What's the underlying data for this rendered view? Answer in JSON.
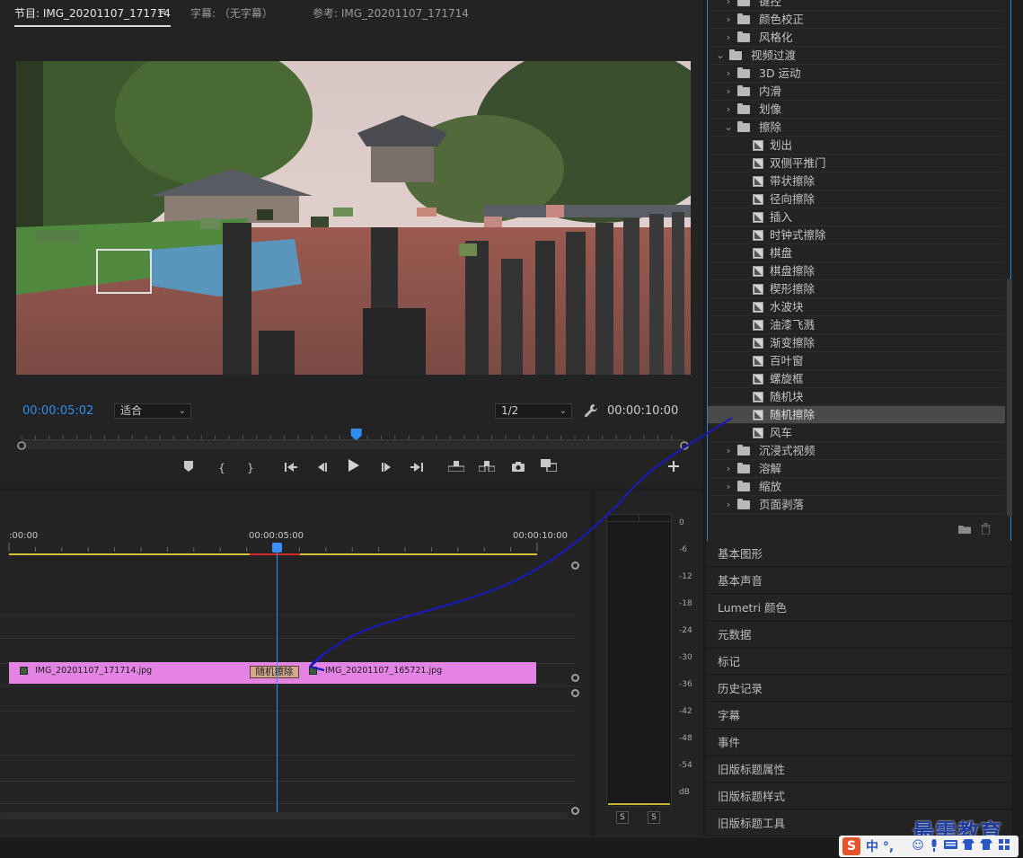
{
  "program_monitor": {
    "tab_active": "节目: IMG_20201107_171714",
    "tab_menu_icon": "hamburger-menu-icon",
    "tab_captions": "字幕: （无字幕）",
    "tab_reference": "参考: IMG_20201107_171714",
    "timecode_current": "00:00:05:02",
    "fit_option": "适合",
    "resolution_option": "1/2",
    "timecode_duration": "00:00:10:00",
    "playhead_progress": 0.505,
    "controls": [
      "marker-icon",
      "in-point-icon",
      "out-point-icon",
      "go-to-in-icon",
      "step-back-icon",
      "play-icon",
      "step-forward-icon",
      "go-to-out-icon",
      "lift-icon",
      "extract-icon",
      "export-frame-icon",
      "compare-icon",
      "add-button-icon"
    ]
  },
  "effects_panel": {
    "rows": [
      {
        "type": "folder",
        "indent": 1,
        "label": "键控",
        "expanded": false
      },
      {
        "type": "folder",
        "indent": 1,
        "label": "颜色校正",
        "expanded": false
      },
      {
        "type": "folder",
        "indent": 1,
        "label": "风格化",
        "expanded": false
      },
      {
        "type": "folder",
        "indent": 0,
        "label": "视频过渡",
        "expanded": true
      },
      {
        "type": "folder",
        "indent": 1,
        "label": "3D 运动",
        "expanded": false
      },
      {
        "type": "folder",
        "indent": 1,
        "label": "内滑",
        "expanded": false
      },
      {
        "type": "folder",
        "indent": 1,
        "label": "划像",
        "expanded": false
      },
      {
        "type": "folder",
        "indent": 1,
        "label": "擦除",
        "expanded": true
      },
      {
        "type": "effect",
        "label": "划出"
      },
      {
        "type": "effect",
        "label": "双侧平推门"
      },
      {
        "type": "effect",
        "label": "带状擦除"
      },
      {
        "type": "effect",
        "label": "径向擦除"
      },
      {
        "type": "effect",
        "label": "插入"
      },
      {
        "type": "effect",
        "label": "时钟式擦除"
      },
      {
        "type": "effect",
        "label": "棋盘"
      },
      {
        "type": "effect",
        "label": "棋盘擦除"
      },
      {
        "type": "effect",
        "label": "楔形擦除"
      },
      {
        "type": "effect",
        "label": "水波块"
      },
      {
        "type": "effect",
        "label": "油漆飞溅"
      },
      {
        "type": "effect",
        "label": "渐变擦除"
      },
      {
        "type": "effect",
        "label": "百叶窗"
      },
      {
        "type": "effect",
        "label": "螺旋框"
      },
      {
        "type": "effect",
        "label": "随机块"
      },
      {
        "type": "effect",
        "label": "随机擦除",
        "selected": true
      },
      {
        "type": "effect",
        "label": "风车"
      },
      {
        "type": "folder",
        "indent": 1,
        "label": "沉浸式视频",
        "expanded": false
      },
      {
        "type": "folder",
        "indent": 1,
        "label": "溶解",
        "expanded": false
      },
      {
        "type": "folder",
        "indent": 1,
        "label": "缩放",
        "expanded": false
      },
      {
        "type": "folder",
        "indent": 1,
        "label": "页面剥落",
        "expanded": false
      }
    ],
    "footer_icons": [
      "new-bin-icon",
      "trash-icon"
    ]
  },
  "panels": [
    "基本图形",
    "基本声音",
    "Lumetri 颜色",
    "元数据",
    "标记",
    "历史记录",
    "字幕",
    "事件",
    "旧版标题属性",
    "旧版标题样式",
    "旧版标题工具"
  ],
  "timeline": {
    "ruler_labels": [
      ":00:00",
      "00:00:05:00",
      "00:00:10:00"
    ],
    "clip_a_name": "IMG_20201107_171714.jpg",
    "clip_b_name": "IMG_20201107_165721.jpg",
    "transition_label": "随机擦除",
    "clip_color": "#e383e3",
    "playhead_color": "#3b8ef3"
  },
  "audio_meter": {
    "scale": [
      "0",
      "-6",
      "-12",
      "-18",
      "-24",
      "-30",
      "-36",
      "-42",
      "-48",
      "-54",
      "dB"
    ],
    "solo_left": "S",
    "solo_right": "S"
  },
  "watermark": "最需教育",
  "ime": {
    "logo": "S",
    "text": "中 °,",
    "icons": [
      "emoji-icon",
      "mic-icon",
      "keyboard-icon",
      "skin-icon",
      "shirt-icon",
      "grid-icon"
    ]
  },
  "colors": {
    "accent_blue": "#2e8ef0",
    "panel_bg": "#232323",
    "annotation_arrow": "#1a1ab8"
  }
}
